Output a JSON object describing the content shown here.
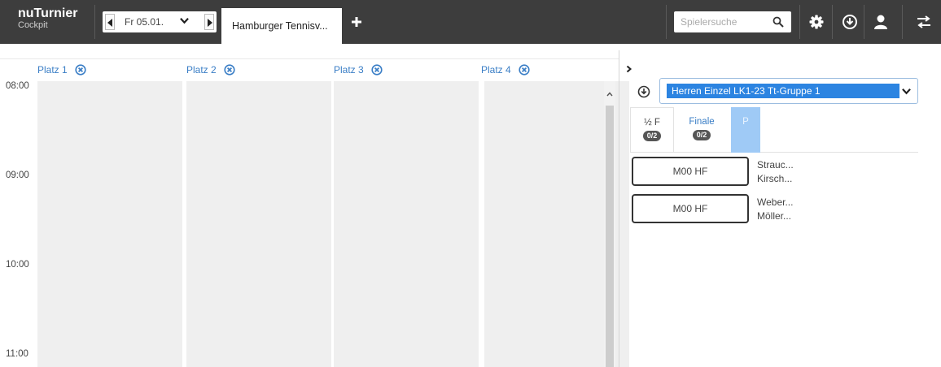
{
  "header": {
    "app_name": "nuTurnier",
    "app_subtitle": "Cockpit",
    "date": "Fr 05.01.",
    "active_tab": "Hamburger Tennisv...",
    "search_placeholder": "Spielersuche",
    "icons": [
      "caret-left-icon",
      "chevron-down-icon",
      "caret-right-icon",
      "plus-icon",
      "search-icon",
      "gear-icon",
      "download-icon",
      "user-icon",
      "swap-icon"
    ],
    "bar_color": "#3d3d3d"
  },
  "calendar": {
    "courts": [
      {
        "label": "Platz 1"
      },
      {
        "label": "Platz 2"
      },
      {
        "label": "Platz 3"
      },
      {
        "label": "Platz 4"
      }
    ],
    "times": [
      "08:00",
      "09:00",
      "10:00",
      "11:00"
    ]
  },
  "panel": {
    "group_select_value": "Herren Einzel LK1-23 Tt-Gruppe 1",
    "rounds": [
      {
        "label": "½ F",
        "badge": "0/2"
      },
      {
        "label": "Finale",
        "badge": "0/2"
      },
      {
        "label": "P",
        "badge": ""
      }
    ],
    "matches": [
      {
        "label": "M00 HF",
        "players": [
          "Strauc...",
          "Kirsch..."
        ]
      },
      {
        "label": "M00 HF",
        "players": [
          "Weber...",
          "Möller..."
        ]
      }
    ],
    "accent_color": "#2c84e1"
  }
}
